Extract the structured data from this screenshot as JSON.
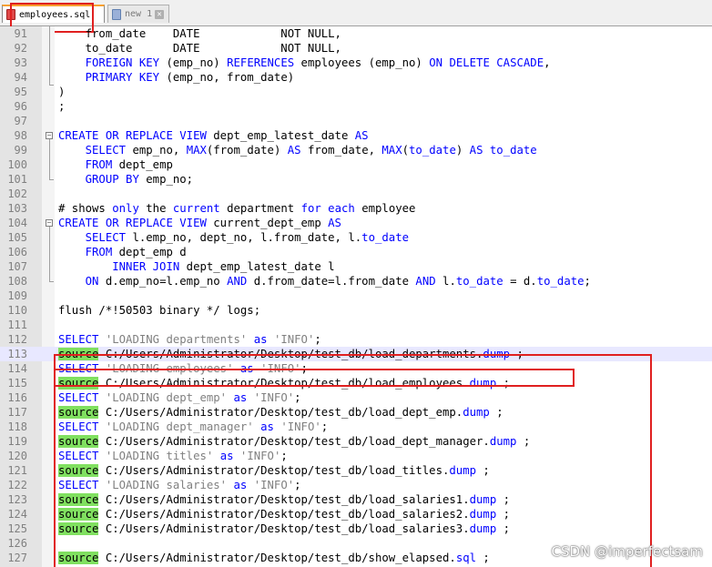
{
  "tabs": [
    {
      "label": "employees.sql",
      "active": true
    },
    {
      "label": "new 1",
      "active": false
    }
  ],
  "lines": [
    {
      "n": "91",
      "segs": [
        {
          "t": "    from_date    DATE            NOT NULL,"
        }
      ]
    },
    {
      "n": "92",
      "segs": [
        {
          "t": "    to_date      DATE            NOT NULL,"
        }
      ]
    },
    {
      "n": "93",
      "segs": [
        {
          "t": "    ",
          "c": ""
        },
        {
          "t": "FOREIGN KEY",
          "c": "kw"
        },
        {
          "t": " (emp_no) "
        },
        {
          "t": "REFERENCES",
          "c": "kw"
        },
        {
          "t": " employees (emp_no) "
        },
        {
          "t": "ON DELETE CASCADE",
          "c": "kw"
        },
        {
          "t": ","
        }
      ]
    },
    {
      "n": "94",
      "segs": [
        {
          "t": "    "
        },
        {
          "t": "PRIMARY KEY",
          "c": "kw"
        },
        {
          "t": " (emp_no, from_date)"
        }
      ]
    },
    {
      "n": "95",
      "segs": [
        {
          "t": ")"
        }
      ]
    },
    {
      "n": "96",
      "segs": [
        {
          "t": ";"
        }
      ]
    },
    {
      "n": "97",
      "segs": [
        {
          "t": ""
        }
      ]
    },
    {
      "n": "98",
      "segs": [
        {
          "t": "CREATE OR REPLACE VIEW",
          "c": "kw"
        },
        {
          "t": " dept_emp_latest_date "
        },
        {
          "t": "AS",
          "c": "kw"
        }
      ]
    },
    {
      "n": "99",
      "segs": [
        {
          "t": "    "
        },
        {
          "t": "SELECT",
          "c": "kw"
        },
        {
          "t": " emp_no, "
        },
        {
          "t": "MAX",
          "c": "kw"
        },
        {
          "t": "(from_date) "
        },
        {
          "t": "AS",
          "c": "kw"
        },
        {
          "t": " from_date, "
        },
        {
          "t": "MAX",
          "c": "kw"
        },
        {
          "t": "("
        },
        {
          "t": "to_date",
          "c": "kw"
        },
        {
          "t": ") "
        },
        {
          "t": "AS",
          "c": "kw"
        },
        {
          "t": " "
        },
        {
          "t": "to_date",
          "c": "kw"
        }
      ]
    },
    {
      "n": "100",
      "segs": [
        {
          "t": "    "
        },
        {
          "t": "FROM",
          "c": "kw"
        },
        {
          "t": " dept_emp"
        }
      ]
    },
    {
      "n": "101",
      "segs": [
        {
          "t": "    "
        },
        {
          "t": "GROUP BY",
          "c": "kw"
        },
        {
          "t": " emp_no;"
        }
      ]
    },
    {
      "n": "102",
      "segs": [
        {
          "t": ""
        }
      ]
    },
    {
      "n": "103",
      "segs": [
        {
          "t": "# shows "
        },
        {
          "t": "only",
          "c": "kw"
        },
        {
          "t": " the "
        },
        {
          "t": "current",
          "c": "kw"
        },
        {
          "t": " department "
        },
        {
          "t": "for each",
          "c": "kw"
        },
        {
          "t": " employee"
        }
      ]
    },
    {
      "n": "104",
      "segs": [
        {
          "t": "CREATE OR REPLACE VIEW",
          "c": "kw"
        },
        {
          "t": " current_dept_emp "
        },
        {
          "t": "AS",
          "c": "kw"
        }
      ]
    },
    {
      "n": "105",
      "segs": [
        {
          "t": "    "
        },
        {
          "t": "SELECT",
          "c": "kw"
        },
        {
          "t": " l.emp_no, dept_no, l.from_date, l."
        },
        {
          "t": "to_date",
          "c": "kw"
        }
      ]
    },
    {
      "n": "106",
      "segs": [
        {
          "t": "    "
        },
        {
          "t": "FROM",
          "c": "kw"
        },
        {
          "t": " dept_emp d"
        }
      ]
    },
    {
      "n": "107",
      "segs": [
        {
          "t": "        "
        },
        {
          "t": "INNER JOIN",
          "c": "kw"
        },
        {
          "t": " dept_emp_latest_date l"
        }
      ]
    },
    {
      "n": "108",
      "segs": [
        {
          "t": "    "
        },
        {
          "t": "ON",
          "c": "kw"
        },
        {
          "t": " d.emp_no=l.emp_no "
        },
        {
          "t": "AND",
          "c": "kw"
        },
        {
          "t": " d.from_date=l.from_date "
        },
        {
          "t": "AND",
          "c": "kw"
        },
        {
          "t": " l."
        },
        {
          "t": "to_date",
          "c": "kw"
        },
        {
          "t": " = d."
        },
        {
          "t": "to_date",
          "c": "kw"
        },
        {
          "t": ";"
        }
      ]
    },
    {
      "n": "109",
      "segs": [
        {
          "t": ""
        }
      ]
    },
    {
      "n": "110",
      "segs": [
        {
          "t": "flush /*!50503 binary */ logs;"
        }
      ]
    },
    {
      "n": "111",
      "segs": [
        {
          "t": ""
        }
      ]
    },
    {
      "n": "112",
      "segs": [
        {
          "t": "SELECT",
          "c": "kw"
        },
        {
          "t": " "
        },
        {
          "t": "'LOADING departments'",
          "c": "str"
        },
        {
          "t": " "
        },
        {
          "t": "as",
          "c": "kw"
        },
        {
          "t": " "
        },
        {
          "t": "'INFO'",
          "c": "str"
        },
        {
          "t": ";"
        }
      ]
    },
    {
      "n": "113",
      "segs": [
        {
          "t": "source",
          "c": "src"
        },
        {
          "t": " C:/Users/Administrator/Desktop/test_db/load_departments."
        },
        {
          "t": "dump",
          "c": "kw"
        },
        {
          "t": " ;"
        }
      ]
    },
    {
      "n": "114",
      "segs": [
        {
          "t": "SELECT",
          "c": "kw"
        },
        {
          "t": " "
        },
        {
          "t": "'LOADING employees'",
          "c": "str"
        },
        {
          "t": " "
        },
        {
          "t": "as",
          "c": "kw"
        },
        {
          "t": " "
        },
        {
          "t": "'INFO'",
          "c": "str"
        },
        {
          "t": ";"
        }
      ]
    },
    {
      "n": "115",
      "segs": [
        {
          "t": "source",
          "c": "src"
        },
        {
          "t": " C:/Users/Administrator/Desktop/test_db/load_employees."
        },
        {
          "t": "dump",
          "c": "kw"
        },
        {
          "t": " ;"
        }
      ]
    },
    {
      "n": "116",
      "segs": [
        {
          "t": "SELECT",
          "c": "kw"
        },
        {
          "t": " "
        },
        {
          "t": "'LOADING dept_emp'",
          "c": "str"
        },
        {
          "t": " "
        },
        {
          "t": "as",
          "c": "kw"
        },
        {
          "t": " "
        },
        {
          "t": "'INFO'",
          "c": "str"
        },
        {
          "t": ";"
        }
      ]
    },
    {
      "n": "117",
      "segs": [
        {
          "t": "source",
          "c": "src"
        },
        {
          "t": " C:/Users/Administrator/Desktop/test_db/load_dept_emp."
        },
        {
          "t": "dump",
          "c": "kw"
        },
        {
          "t": " ;"
        }
      ]
    },
    {
      "n": "118",
      "segs": [
        {
          "t": "SELECT",
          "c": "kw"
        },
        {
          "t": " "
        },
        {
          "t": "'LOADING dept_manager'",
          "c": "str"
        },
        {
          "t": " "
        },
        {
          "t": "as",
          "c": "kw"
        },
        {
          "t": " "
        },
        {
          "t": "'INFO'",
          "c": "str"
        },
        {
          "t": ";"
        }
      ]
    },
    {
      "n": "119",
      "segs": [
        {
          "t": "source",
          "c": "src"
        },
        {
          "t": " C:/Users/Administrator/Desktop/test_db/load_dept_manager."
        },
        {
          "t": "dump",
          "c": "kw"
        },
        {
          "t": " ;"
        }
      ]
    },
    {
      "n": "120",
      "segs": [
        {
          "t": "SELECT",
          "c": "kw"
        },
        {
          "t": " "
        },
        {
          "t": "'LOADING titles'",
          "c": "str"
        },
        {
          "t": " "
        },
        {
          "t": "as",
          "c": "kw"
        },
        {
          "t": " "
        },
        {
          "t": "'INFO'",
          "c": "str"
        },
        {
          "t": ";"
        }
      ]
    },
    {
      "n": "121",
      "segs": [
        {
          "t": "source",
          "c": "src"
        },
        {
          "t": " C:/Users/Administrator/Desktop/test_db/load_titles."
        },
        {
          "t": "dump",
          "c": "kw"
        },
        {
          "t": " ;"
        }
      ]
    },
    {
      "n": "122",
      "segs": [
        {
          "t": "SELECT",
          "c": "kw"
        },
        {
          "t": " "
        },
        {
          "t": "'LOADING salaries'",
          "c": "str"
        },
        {
          "t": " "
        },
        {
          "t": "as",
          "c": "kw"
        },
        {
          "t": " "
        },
        {
          "t": "'INFO'",
          "c": "str"
        },
        {
          "t": ";"
        }
      ]
    },
    {
      "n": "123",
      "segs": [
        {
          "t": "source",
          "c": "src"
        },
        {
          "t": " C:/Users/Administrator/Desktop/test_db/load_salaries1."
        },
        {
          "t": "dump",
          "c": "kw"
        },
        {
          "t": " ;"
        }
      ]
    },
    {
      "n": "124",
      "segs": [
        {
          "t": "source",
          "c": "src"
        },
        {
          "t": " C:/Users/Administrator/Desktop/test_db/load_salaries2."
        },
        {
          "t": "dump",
          "c": "kw"
        },
        {
          "t": " ;"
        }
      ]
    },
    {
      "n": "125",
      "segs": [
        {
          "t": "source",
          "c": "src"
        },
        {
          "t": " C:/Users/Administrator/Desktop/test_db/load_salaries3."
        },
        {
          "t": "dump",
          "c": "kw"
        },
        {
          "t": " ;"
        }
      ]
    },
    {
      "n": "126",
      "segs": [
        {
          "t": ""
        }
      ]
    },
    {
      "n": "127",
      "segs": [
        {
          "t": "source",
          "c": "src"
        },
        {
          "t": " C:/Users/Administrator/Desktop/test_db/show_elapsed."
        },
        {
          "t": "sql",
          "c": "kw"
        },
        {
          "t": " ;"
        }
      ]
    }
  ],
  "current_line": "113",
  "watermark": "CSDN @imperfectsam",
  "colors": {
    "keyword": "#0000ff",
    "string": "#808080",
    "source_highlight": "#80e060",
    "annotation": "#e02020"
  }
}
